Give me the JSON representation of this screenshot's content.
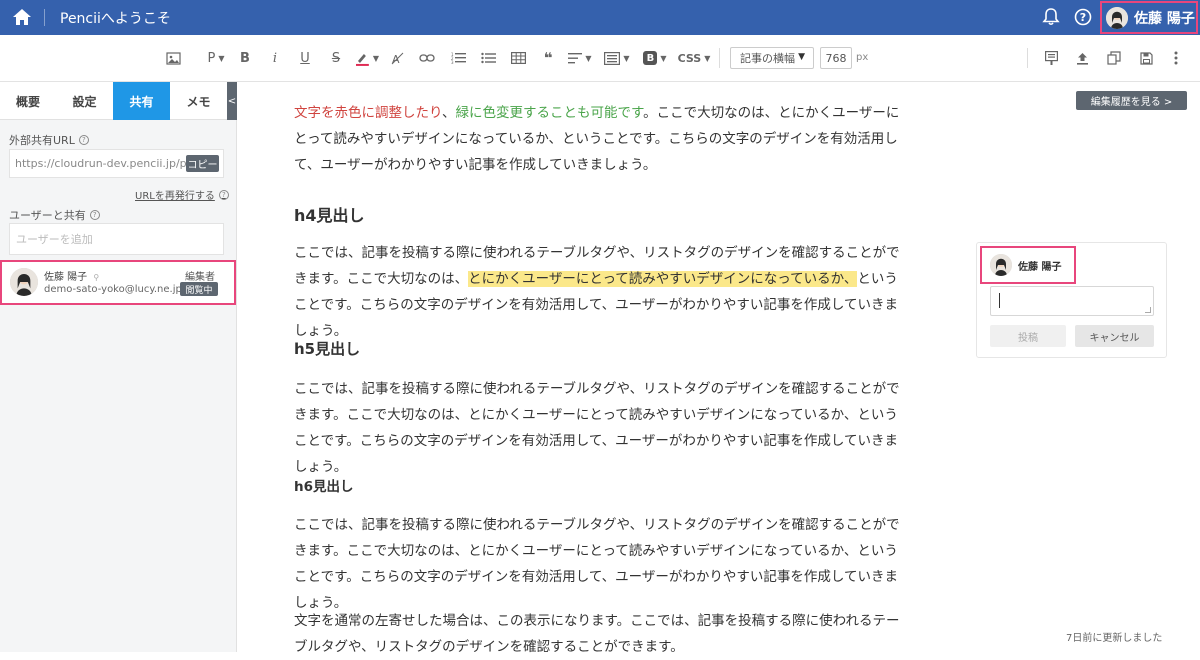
{
  "topbar": {
    "title": "Penciiへようこそ",
    "user_name": "佐藤 陽子"
  },
  "toolbar": {
    "paragraph_label": "P",
    "bold_label": "B",
    "italic_label": "i",
    "underline_label": "U",
    "strike_label": "S",
    "quote_label": "❝",
    "b_badge_label": "B",
    "css_label": "CSS",
    "width_select": "記事の横幅",
    "width_value": "768",
    "width_unit": "px"
  },
  "sidebar": {
    "tabs": [
      {
        "label": "概要"
      },
      {
        "label": "設定"
      },
      {
        "label": "共有"
      },
      {
        "label": "メモ"
      }
    ],
    "collapse_label": "<",
    "external_url_label": "外部共有URL",
    "external_url_value": "https://cloudrun-dev.pencii.jp/public-",
    "copy_label": "コピー",
    "reissue_label": "URLを再発行する",
    "share_users_label": "ユーザーと共有",
    "add_user_placeholder": "ユーザーを追加",
    "member": {
      "name": "佐藤 陽子",
      "email": "demo-sato-yoko@lucy.ne.jp",
      "role": "編集者",
      "status": "閲覧中"
    }
  },
  "content": {
    "history_button": "編集履歴を見る >",
    "intro": {
      "red": "文字を赤色に調整したり",
      "sep": "、",
      "green": "緑に色変更することも可能です",
      "rest": "。ここで大切なのは、とにかくユーザーにとって読みやすいデザインになっているか、ということです。こちらの文字のデザインを有効活用して、ユーザーがわかりやすい記事を作成していきましょう。"
    },
    "h4": "h4見出し",
    "h4_para": {
      "before": "ここでは、記事を投稿する際に使われるテーブルタグや、リストタグのデザインを確認することができます。ここで大切なのは、",
      "highlight": "とにかくユーザーにとって読みやすいデザインになっているか、",
      "after": "ということです。こちらの文字のデザインを有効活用して、ユーザーがわかりやすい記事を作成していきましょう。"
    },
    "h5": "h5見出し",
    "h5_para": "ここでは、記事を投稿する際に使われるテーブルタグや、リストタグのデザインを確認することができます。ここで大切なのは、とにかくユーザーにとって読みやすいデザインになっているか、ということです。こちらの文字のデザインを有効活用して、ユーザーがわかりやすい記事を作成していきましょう。",
    "h6": "h6見出し",
    "h6_para": "ここでは、記事を投稿する際に使われるテーブルタグや、リストタグのデザインを確認することができます。ここで大切なのは、とにかくユーザーにとって読みやすいデザインになっているか、ということです。こちらの文字のデザインを有効活用して、ユーザーがわかりやすい記事を作成していきましょう。",
    "left_para": "文字を通常の左寄せした場合は、この表示になります。ここでは、記事を投稿する際に使われるテーブルタグや、リストタグのデザインを確認することができます。",
    "updated": "7日前に更新しました"
  },
  "comment": {
    "user_name": "佐藤 陽子",
    "post_label": "投稿",
    "cancel_label": "キャンセル"
  },
  "colors": {
    "header": "#3561ad",
    "active_tab": "#1f97e6",
    "highlight_border": "#e8467c",
    "red_text": "#d0443f",
    "green_text": "#4aa44a",
    "marker": "#fbe88a"
  }
}
